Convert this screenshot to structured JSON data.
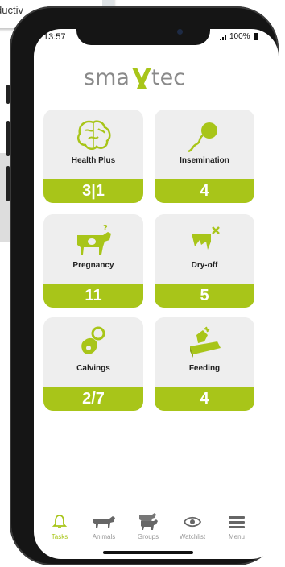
{
  "background_window": {
    "text": "ductiv"
  },
  "status_bar": {
    "time": "13:57",
    "battery": "100%"
  },
  "app": {
    "brand": "smaxtec",
    "accent_color": "#a8c519"
  },
  "tiles": [
    {
      "label": "Health Plus",
      "count": "3|1",
      "icon": "brain-icon"
    },
    {
      "label": "Insemination",
      "count": "4",
      "icon": "sperm-icon"
    },
    {
      "label": "Pregnancy",
      "count": "11",
      "icon": "cow-question-icon"
    },
    {
      "label": "Dry-off",
      "count": "5",
      "icon": "udder-cross-icon"
    },
    {
      "label": "Calvings",
      "count": "2/7",
      "icon": "pacifier-icon"
    },
    {
      "label": "Feeding",
      "count": "4",
      "icon": "feed-trough-icon"
    }
  ],
  "tabs": [
    {
      "label": "Tasks",
      "icon": "bell-icon",
      "active": true
    },
    {
      "label": "Animals",
      "icon": "cow-icon",
      "active": false
    },
    {
      "label": "Groups",
      "icon": "cows-group-icon",
      "active": false
    },
    {
      "label": "Watchlist",
      "icon": "eye-icon",
      "active": false
    },
    {
      "label": "Menu",
      "icon": "menu-icon",
      "active": false
    }
  ]
}
